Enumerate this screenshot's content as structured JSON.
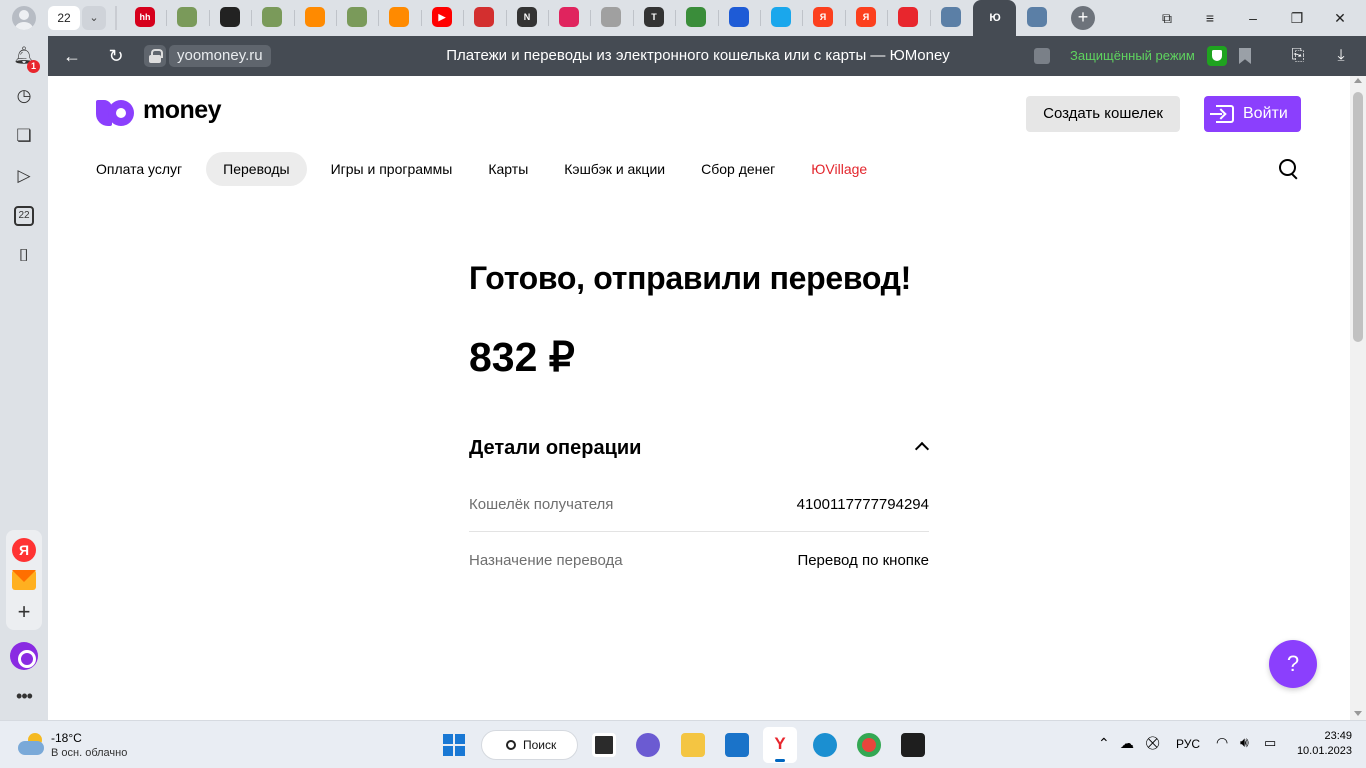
{
  "browser": {
    "tab_count": "22",
    "url_domain": "yoomoney.ru",
    "page_title": "Платежи и переводы из электронного кошелька или с карты — ЮMoney",
    "protected_mode": "Защищённый режим",
    "active_tab_label": "Ю",
    "sidebar_calendar": "22",
    "notifications_badge": "1",
    "pinned_tabs": [
      {
        "label": "hh",
        "color": "#d6001c"
      },
      {
        "label": "",
        "color": "#7a9a5a"
      },
      {
        "label": "",
        "color": "#222222"
      },
      {
        "label": "",
        "color": "#7a9a5a"
      },
      {
        "label": "",
        "color": "#ff8a00"
      },
      {
        "label": "",
        "color": "#7a9a5a"
      },
      {
        "label": "",
        "color": "#ff8a00"
      },
      {
        "label": "▶",
        "color": "#ff0000"
      },
      {
        "label": "",
        "color": "#d32f2f"
      },
      {
        "label": "N",
        "color": "#333333"
      },
      {
        "label": "",
        "color": "#e0245e"
      },
      {
        "label": "",
        "color": "#a0a0a0"
      },
      {
        "label": "T",
        "color": "#333333"
      },
      {
        "label": "",
        "color": "#3a8d3a"
      },
      {
        "label": "",
        "color": "#1e5bd6"
      },
      {
        "label": "",
        "color": "#1aa7ec"
      },
      {
        "label": "Я",
        "color": "#fc3f1d"
      },
      {
        "label": "Я",
        "color": "#fc3f1d"
      },
      {
        "label": "",
        "color": "#e8262d"
      },
      {
        "label": "",
        "color": "#5b7fa6"
      }
    ]
  },
  "site": {
    "logo_text": "money",
    "create_wallet": "Создать кошелек",
    "login": "Войти",
    "nav": [
      {
        "label": "Оплата услуг"
      },
      {
        "label": "Переводы"
      },
      {
        "label": "Игры и программы"
      },
      {
        "label": "Карты"
      },
      {
        "label": "Кэшбэк и акции"
      },
      {
        "label": "Сбор денег"
      },
      {
        "label": "ЮVillage"
      }
    ],
    "heading": "Готово, отправили перевод!",
    "amount": "832 ₽",
    "details_title": "Детали операции",
    "details": [
      {
        "label": "Кошелёк получателя",
        "value": "4100117777794294"
      },
      {
        "label": "Назначение перевода",
        "value": "Перевод по кнопке"
      }
    ],
    "help": "?"
  },
  "taskbar": {
    "weather_temp": "-18°C",
    "weather_desc": "В осн. облачно",
    "search_label": "Поиск",
    "language": "РУС",
    "time": "23:49",
    "date": "10.01.2023"
  },
  "colors": {
    "brand": "#8b3ffd",
    "accent_red": "#e3262d",
    "protected_green": "#5fd35f"
  }
}
